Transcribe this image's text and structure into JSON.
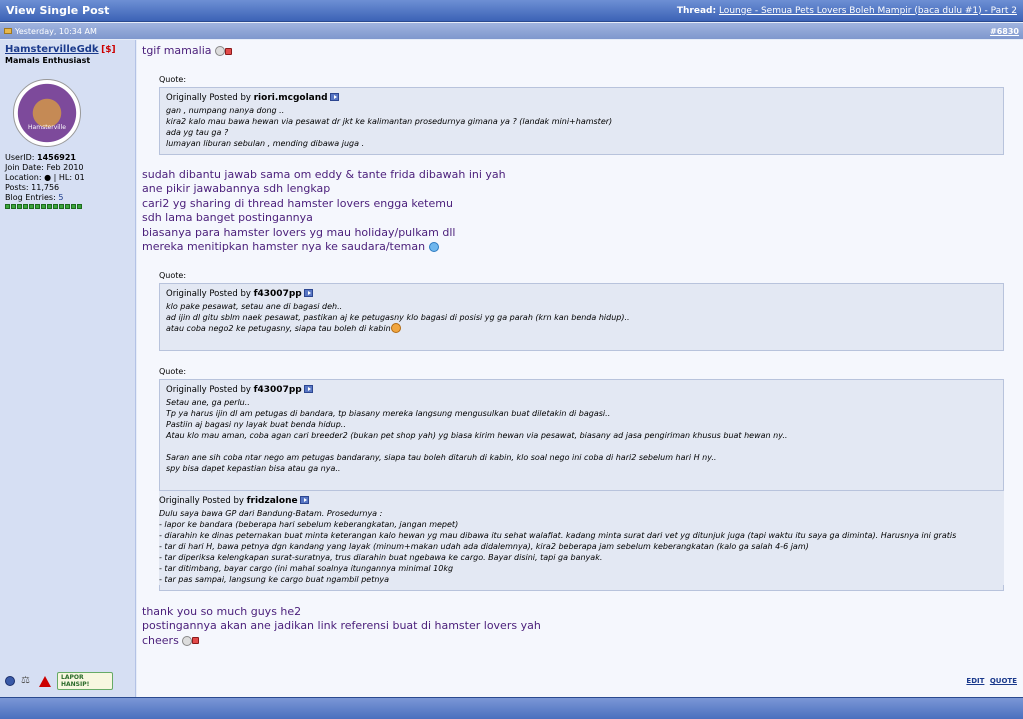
{
  "header": {
    "title": "View Single Post",
    "thread_label": "Thread:",
    "thread_link": "Lounge - Semua Pets Lovers Boleh Mampir (baca dulu #1) - Part 2"
  },
  "datebar": {
    "date": "Yesterday, 10:34 AM",
    "post_number": "#6830"
  },
  "user": {
    "name": "HamstervilleGdk",
    "badge": "[$]",
    "title": "Mamals Enthusiast",
    "avatar_text": "Hamsterville",
    "userid_label": "UserID:",
    "userid": "1456921",
    "join_label": "Join Date:",
    "join_date": "Feb 2010",
    "location_label": "Location:",
    "location_value": "| HL: 01",
    "posts_label": "Posts:",
    "posts": "11,756",
    "blog_label": "Blog Entries:",
    "blog_entries": "5",
    "hansip_line1": "LAPOR",
    "hansip_line2": "HANSIP!"
  },
  "post": {
    "opening": "tgif mamalia",
    "quote_label": "Quote:",
    "originally_posted_by": "Originally Posted by",
    "quote1": {
      "author": "riori.mcgoland",
      "lines": [
        "gan , numpang nanya dong ..",
        "kira2 kalo mau bawa hewan via pesawat dr jkt ke kalimantan prosedurnya gimana ya ? (landak mini+hamster)",
        "ada yg tau ga ?",
        "lumayan liburan sebulan , mending dibawa juga ."
      ]
    },
    "middle_lines": [
      "sudah dibantu jawab sama om eddy & tante frida dibawah ini yah",
      "ane pikir jawabannya sdh lengkap",
      "cari2 yg sharing di thread hamster lovers engga ketemu",
      "sdh lama banget postingannya",
      "biasanya para hamster lovers yg mau holiday/pulkam dll",
      "mereka menitipkan hamster nya ke saudara/teman"
    ],
    "quote2": {
      "author": "f43007pp",
      "lines": [
        "klo pake pesawat, setau ane di bagasi deh..",
        "ad ijin dl gitu sblm naek pesawat, pastikan aj ke petugasny klo bagasi di posisi yg ga parah (krn kan benda hidup)..",
        "atau coba nego2 ke petugasny, siapa tau boleh di kabin"
      ]
    },
    "quote3": {
      "author": "f43007pp",
      "lines": [
        "Setau ane, ga perlu..",
        "Tp ya harus ijin dl am petugas di bandara, tp biasany mereka langsung mengusulkan buat diletakin di bagasi..",
        "Pastiin aj bagasi ny layak buat benda hidup..",
        "Atau klo mau aman, coba agan cari breeder2 (bukan pet shop yah) yg biasa kirim hewan via pesawat, biasany ad jasa pengiriman khusus buat hewan ny..",
        "",
        "Saran ane sih coba ntar nego am petugas bandarany, siapa tau boleh ditaruh di kabin, klo soal nego ini coba di hari2 sebelum hari H ny..",
        "spy bisa dapet kepastian bisa atau ga nya.."
      ]
    },
    "quote4": {
      "author": "fridzalone",
      "lines": [
        "Dulu saya bawa GP dari Bandung-Batam. Prosedurnya :",
        "- lapor ke bandara (beberapa hari sebelum keberangkatan, jangan mepet)",
        "- diarahin ke dinas peternakan buat minta keterangan kalo hewan yg mau dibawa itu sehat walafiat. kadang minta surat dari vet yg ditunjuk juga (tapi waktu itu saya ga diminta). Harusnya ini gratis",
        "- tar di hari H, bawa petnya dgn kandang yang layak (minum+makan udah ada didalemnya), kira2 beberapa jam sebelum keberangkatan (kalo ga salah 4-6 jam)",
        "- tar diperiksa kelengkapan surat-suratnya, trus diarahin buat ngebawa ke cargo. Bayar disini, tapi ga banyak.",
        "- tar ditimbang, bayar cargo (ini mahal soalnya itungannya minimal 10kg",
        "- tar pas sampai, langsung ke cargo buat ngambil petnya"
      ]
    },
    "closing_lines": [
      "thank you so much guys he2",
      "postingannya akan ane jadikan link referensi buat di hamster lovers yah",
      "cheers"
    ]
  },
  "actions": {
    "edit": "EDIT",
    "quote": "QUOTE"
  }
}
